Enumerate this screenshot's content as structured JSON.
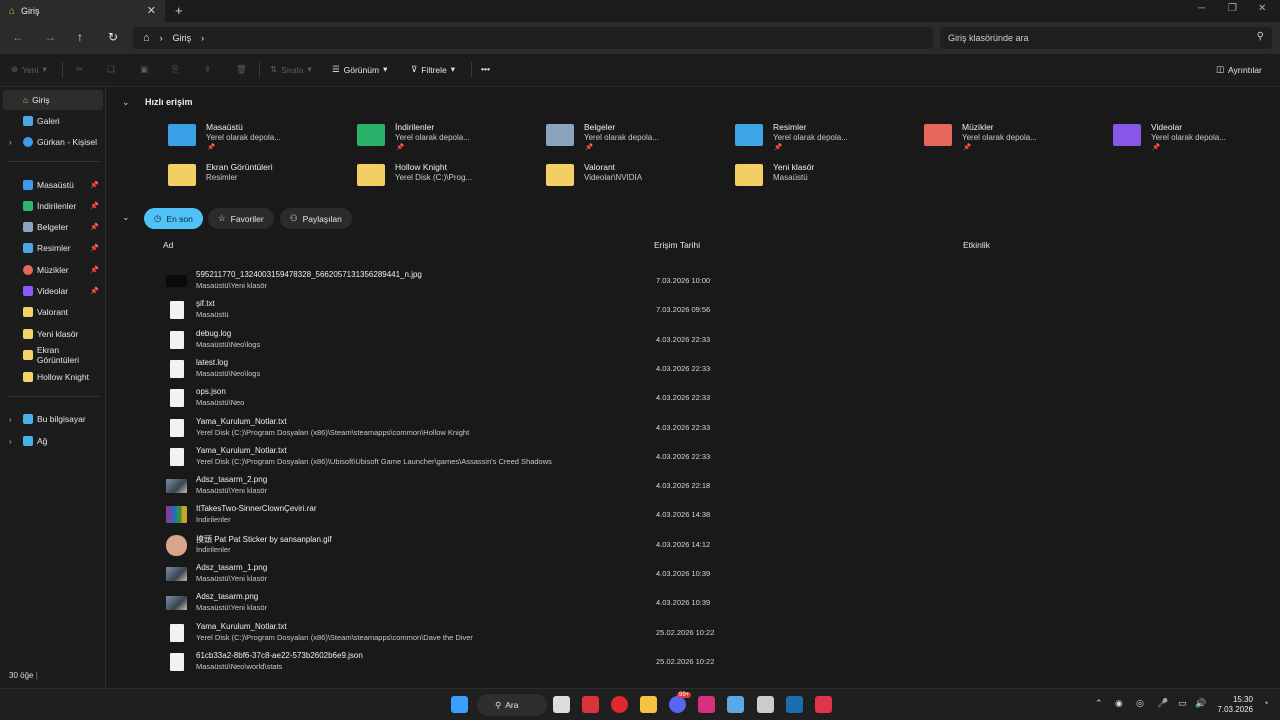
{
  "window": {
    "tab_title": "Giriş",
    "close_tab": "✕",
    "new_tab": "+"
  },
  "nav": {
    "breadcrumb": "Giriş",
    "search_placeholder": "Giriş klasöründe ara"
  },
  "toolbar": {
    "new_label": "Yeni",
    "sort_label": "Sırala",
    "view_label": "Görünüm",
    "filter_label": "Filtrele",
    "more_label": "•••",
    "details_label": "Ayrıntılar"
  },
  "sidebar": {
    "top": [
      {
        "label": "Giriş"
      },
      {
        "label": "Galeri"
      },
      {
        "label": "Gürkan - Kişisel"
      }
    ],
    "pinned": [
      {
        "label": "Masaüstü",
        "color": "#3d9be9"
      },
      {
        "label": "İndirilenler",
        "color": "#2fb56a"
      },
      {
        "label": "Belgeler",
        "color": "#8aa4c0"
      },
      {
        "label": "Resimler",
        "color": "#4aa8e0"
      },
      {
        "label": "Müzikler",
        "color": "#e8675b"
      },
      {
        "label": "Videolar",
        "color": "#8b5cf6"
      },
      {
        "label": "Valorant",
        "color": "#f5d36b"
      },
      {
        "label": "Yeni klasör",
        "color": "#f5d36b"
      },
      {
        "label": "Ekran Görüntüleri",
        "color": "#f5d36b"
      },
      {
        "label": "Hollow Knight",
        "color": "#f5d36b"
      }
    ],
    "bottom": [
      {
        "label": "Bu bilgisayar"
      },
      {
        "label": "Ağ"
      }
    ]
  },
  "quick_access": {
    "title": "Hızlı erişim",
    "items": [
      {
        "name": "Masaüstü",
        "sub": "Yerel olarak depola...",
        "pinned": true,
        "color": "#3aa0e8"
      },
      {
        "name": "İndirilenler",
        "sub": "Yerel olarak depola...",
        "pinned": true,
        "color": "#29b36a"
      },
      {
        "name": "Belgeler",
        "sub": "Yerel olarak depola...",
        "pinned": true,
        "color": "#8aa4c0"
      },
      {
        "name": "Resimler",
        "sub": "Yerel olarak depola...",
        "pinned": true,
        "color": "#3fa6e6"
      },
      {
        "name": "Müzikler",
        "sub": "Yerel olarak depola...",
        "pinned": true,
        "color": "#e9665c"
      },
      {
        "name": "Videolar",
        "sub": "Yerel olarak depola...",
        "pinned": true,
        "color": "#8757e8"
      },
      {
        "name": "Ekran Görüntüleri",
        "sub": "Resimler",
        "pinned": false,
        "color": "#f3cf63"
      },
      {
        "name": "Hollow Knight",
        "sub": "Yerel Disk (C:)\\Prog...",
        "pinned": false,
        "color": "#f3cf63"
      },
      {
        "name": "Valorant",
        "sub": "Videolar\\NVIDIA",
        "pinned": false,
        "color": "#f3cf63"
      },
      {
        "name": "Yeni klasör",
        "sub": "Masaüstü",
        "pinned": false,
        "color": "#f3cf63"
      }
    ]
  },
  "filters": {
    "recent": "En son",
    "favorites": "Favoriler",
    "shared": "Paylaşılan"
  },
  "columns": {
    "name": "Ad",
    "date": "Erişim Tarihi",
    "activity": "Etkinlik"
  },
  "files": [
    {
      "name": "595211770_1324003159478328_5662057131356289441_n.jpg",
      "path": "Masaüstü\\Yeni klasör",
      "date": "7.03.2026 10:00",
      "icon": "dark"
    },
    {
      "name": "şif.txt",
      "path": "Masaüstü",
      "date": "7.03.2026 09:56",
      "icon": "doc"
    },
    {
      "name": "debug.log",
      "path": "Masaüstü\\Neo\\logs",
      "date": "4.03.2026 22:33",
      "icon": "doc"
    },
    {
      "name": "latest.log",
      "path": "Masaüstü\\Neo\\logs",
      "date": "4.03.2026 22:33",
      "icon": "doc"
    },
    {
      "name": "ops.json",
      "path": "Masaüstü\\Neo",
      "date": "4.03.2026 22:33",
      "icon": "doc"
    },
    {
      "name": "Yama_Kurulum_Notlar.txt",
      "path": "Yerel Disk (C:)\\Program Dosyaları (x86)\\Steam\\steamapps\\common\\Hollow Knight",
      "date": "4.03.2026 22:33",
      "icon": "doc"
    },
    {
      "name": "Yama_Kurulum_Notlar.txt",
      "path": "Yerel Disk (C:)\\Program Dosyaları (x86)\\Ubisoft\\Ubisoft Game Launcher\\games\\Assassin's Creed Shadows",
      "date": "4.03.2026 22:33",
      "icon": "doc"
    },
    {
      "name": "Adsz_tasarm_2.png",
      "path": "Masaüstü\\Yeni klasör",
      "date": "4.03.2026 22:18",
      "icon": "img"
    },
    {
      "name": "ItTakesTwo-SinnerClownÇeviri.rar",
      "path": "İndirilenler",
      "date": "4.03.2026 14:38",
      "icon": "rar"
    },
    {
      "name": "摸頭 Pat Pat Sticker by sansanplan.gif",
      "path": "İndirilenler",
      "date": "4.03.2026 14:12",
      "icon": "gif"
    },
    {
      "name": "Adsz_tasarm_1.png",
      "path": "Masaüstü\\Yeni klasör",
      "date": "4.03.2026 10:39",
      "icon": "img"
    },
    {
      "name": "Adsz_tasarm.png",
      "path": "Masaüstü\\Yeni klasör",
      "date": "4.03.2026 10:39",
      "icon": "img"
    },
    {
      "name": "Yama_Kurulum_Notlar.txt",
      "path": "Yerel Disk (C:)\\Program Dosyaları (x86)\\Steam\\steamapps\\common\\Dave the Diver",
      "date": "25.02.2026 10:22",
      "icon": "doc"
    },
    {
      "name": "61cb33a2-8bf6-37c8-ae22-573b2602b6e9.json",
      "path": "Masaüstü\\Neo\\world\\stats",
      "date": "25.02.2026 10:22",
      "icon": "doc"
    }
  ],
  "status": {
    "count": "30 öğe"
  },
  "taskbar": {
    "search_label": "Ara",
    "discord_badge": "99+",
    "time": "15:30",
    "date": "7.03.2026",
    "apps": [
      {
        "name": "windows-start",
        "color": "#3aa0ff"
      },
      {
        "name": "task-view",
        "color": "#dddddd"
      },
      {
        "name": "app-red",
        "color": "#d9343c"
      },
      {
        "name": "opera",
        "color": "#e0262e"
      },
      {
        "name": "file-explorer",
        "color": "#f3c341"
      },
      {
        "name": "discord",
        "color": "#5865f2"
      },
      {
        "name": "instagram",
        "color": "#d6307c"
      },
      {
        "name": "app-blue",
        "color": "#5aa9e6"
      },
      {
        "name": "app-dark",
        "color": "#cccccc"
      },
      {
        "name": "steam",
        "color": "#1b6db0"
      },
      {
        "name": "app-pink",
        "color": "#e0334c"
      }
    ]
  }
}
